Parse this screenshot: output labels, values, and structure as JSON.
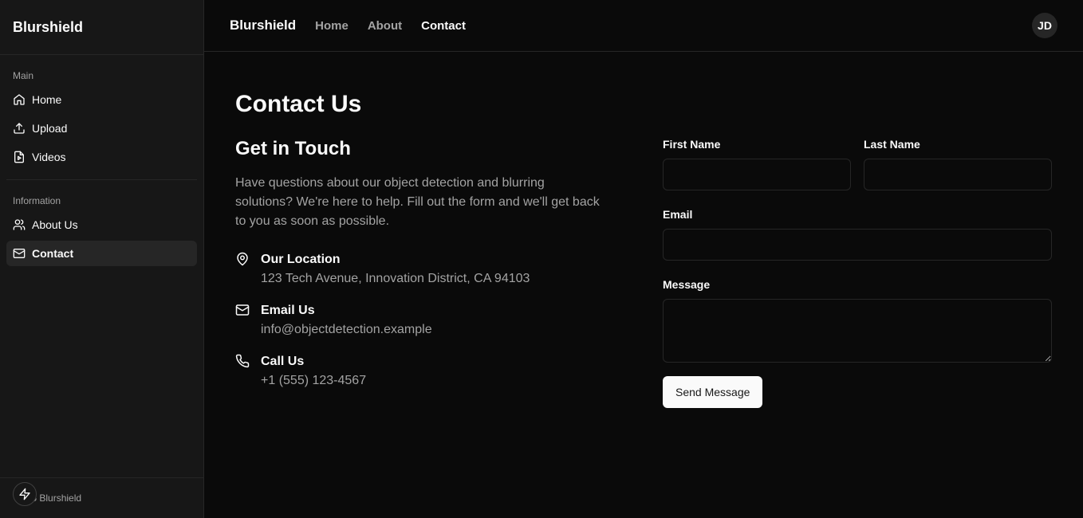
{
  "sidebar": {
    "brand": "Blurshield",
    "groups": [
      {
        "label": "Main",
        "items": [
          {
            "label": "Home",
            "icon": "home-icon"
          },
          {
            "label": "Upload",
            "icon": "upload-icon"
          },
          {
            "label": "Videos",
            "icon": "video-file-icon"
          }
        ]
      },
      {
        "label": "Information",
        "items": [
          {
            "label": "About Us",
            "icon": "users-icon"
          },
          {
            "label": "Contact",
            "icon": "mail-icon",
            "active": true
          }
        ]
      }
    ],
    "footer": "025 Blurshield"
  },
  "topbar": {
    "brand": "Blurshield",
    "links": [
      "Home",
      "About",
      "Contact"
    ],
    "active_link": "Contact",
    "avatar_initials": "JD"
  },
  "page": {
    "title": "Contact Us",
    "subtitle": "Get in Touch",
    "intro": "Have questions about our object detection and blurring solutions? We're here to help. Fill out the form and we'll get back to you as soon as possible.",
    "contacts": [
      {
        "title": "Our Location",
        "text": "123 Tech Avenue, Innovation District, CA 94103",
        "icon": "map-pin-icon"
      },
      {
        "title": "Email Us",
        "text": "info@objectdetection.example",
        "icon": "mail-icon"
      },
      {
        "title": "Call Us",
        "text": "+1 (555) 123-4567",
        "icon": "phone-icon"
      }
    ]
  },
  "form": {
    "first_name_label": "First Name",
    "last_name_label": "Last Name",
    "email_label": "Email",
    "message_label": "Message",
    "submit_label": "Send Message"
  },
  "colors": {
    "background": "#0a0a0a",
    "sidebar": "#171717",
    "border": "#262626",
    "muted_text": "#a3a3a3",
    "button": "#fafafa"
  }
}
